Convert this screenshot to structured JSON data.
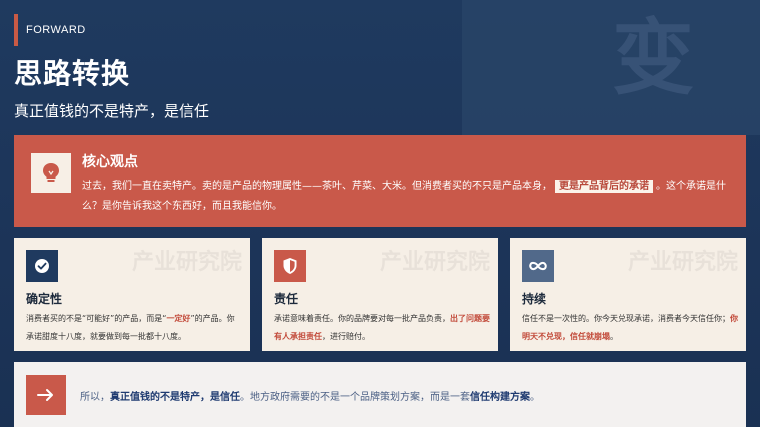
{
  "header": {
    "eyebrow": "FORWARD",
    "title": "思路转换",
    "subtitle": "真正值钱的不是特产，是信任",
    "watermark_char": "变"
  },
  "core": {
    "icon": "lightbulb-icon",
    "heading": "核心观点",
    "text_before": "过去，我们一直在卖特产。卖的是产品的物理属性——茶叶、芹菜、大米。但消费者买的不只是产品本身，",
    "highlight": "更是产品背后的承诺",
    "text_after": "。这个承诺是什么？是你告诉我这个东西好，而且我能信你。"
  },
  "cards": [
    {
      "icon": "check-circle-icon",
      "title": "确定性",
      "text_before": "消费者买的不是“可能好”的产品，而是“",
      "accent": "一定好",
      "text_after": "”的产品。你承诺甜度十八度，就要做到每一批都十八度。",
      "watermark": "产业研究院"
    },
    {
      "icon": "shield-icon",
      "title": "责任",
      "text_before": "承诺意味着责任。你的品牌要对每一批产品负责，",
      "accent": "出了问题要有人承担责任",
      "text_after": "，进行赔付。",
      "watermark": "产业研究院"
    },
    {
      "icon": "infinity-icon",
      "title": "持续",
      "text_before": "信任不是一次性的。你今天兑现承诺，消费者今天信任你；",
      "accent": "你明天不兑现，信任就崩塌",
      "text_after": "。",
      "watermark": "产业研究院"
    }
  ],
  "bottom": {
    "icon": "arrow-right-icon",
    "text_1": "所以，",
    "accent_1": "真正值钱的不是特产，是信任",
    "text_2": "。地方政府需要的不是一个品牌策划方案，而是一套",
    "accent_2": "信任构建方案",
    "text_3": "。"
  },
  "colors": {
    "background": "#1e3658",
    "accent_red": "#c9594a",
    "card_bg": "#f6efe6",
    "navy": "#1f3a5f",
    "slate": "#51698a"
  }
}
